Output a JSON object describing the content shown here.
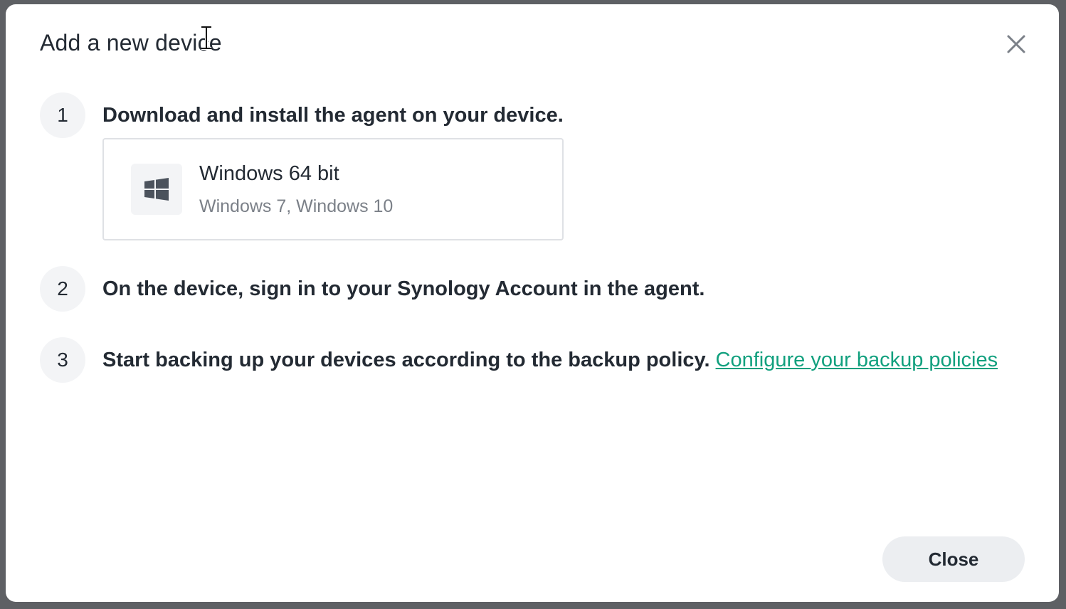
{
  "dialog": {
    "title": "Add a new device",
    "close_icon": "close-icon"
  },
  "steps": [
    {
      "number": "1",
      "text": "Download and install the agent on your device."
    },
    {
      "number": "2",
      "text": "On the device, sign in to your Synology Account in the agent."
    },
    {
      "number": "3",
      "text": "Start backing up your devices according to the backup policy.",
      "link": "Configure your backup policies"
    }
  ],
  "download": {
    "icon": "windows-icon",
    "title": "Windows 64 bit",
    "subtitle": "Windows 7, Windows 10"
  },
  "footer": {
    "close_label": "Close"
  },
  "colors": {
    "link": "#11a07e",
    "text": "#232a33",
    "muted": "#7b8088",
    "step_circle": "#f3f4f6",
    "button_bg": "#eceef1"
  }
}
